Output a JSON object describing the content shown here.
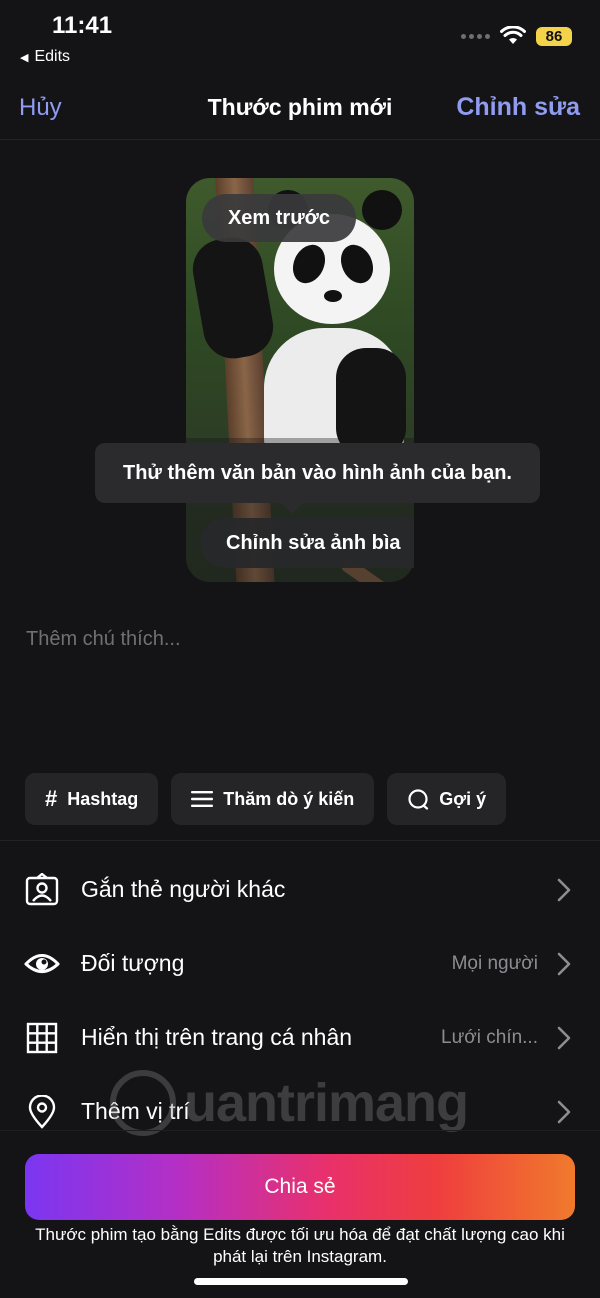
{
  "status_bar": {
    "time": "11:41",
    "back_app": "Edits",
    "battery": "86"
  },
  "nav": {
    "cancel": "Hủy",
    "title": "Thước phim mới",
    "edit": "Chỉnh sửa"
  },
  "preview": {
    "preview_label": "Xem trước",
    "tooltip": "Thử thêm văn bản vào hình ảnh của bạn.",
    "edit_cover": "Chỉnh sửa ảnh bìa"
  },
  "caption": {
    "placeholder": "Thêm chú thích..."
  },
  "chips": [
    {
      "icon": "hash-icon",
      "label": "Hashtag"
    },
    {
      "icon": "list-icon",
      "label": "Thăm dò ý kiến"
    },
    {
      "icon": "chat-bubble-icon",
      "label": "Gợi ý"
    }
  ],
  "settings": [
    {
      "icon": "tag-person-icon",
      "label": "Gắn thẻ người khác",
      "value": ""
    },
    {
      "icon": "eye-icon",
      "label": "Đối tượng",
      "value": "Mọi người"
    },
    {
      "icon": "grid-icon",
      "label": "Hiển thị trên trang cá nhân",
      "value": "Lưới chín..."
    },
    {
      "icon": "location-pin-icon",
      "label": "Thêm vị trí",
      "value": ""
    }
  ],
  "watermark": {
    "text": "uantrimang"
  },
  "share": {
    "label": "Chia sẻ",
    "note": "Thước phim tạo bằng Edits được tối ưu hóa để đạt chất lượng cao khi phát lại trên Instagram."
  },
  "colors": {
    "background": "#141417",
    "accent": "#8f9cf0",
    "share_gradient": [
      "#7b36f2",
      "#e9306b",
      "#f07a2c"
    ]
  }
}
